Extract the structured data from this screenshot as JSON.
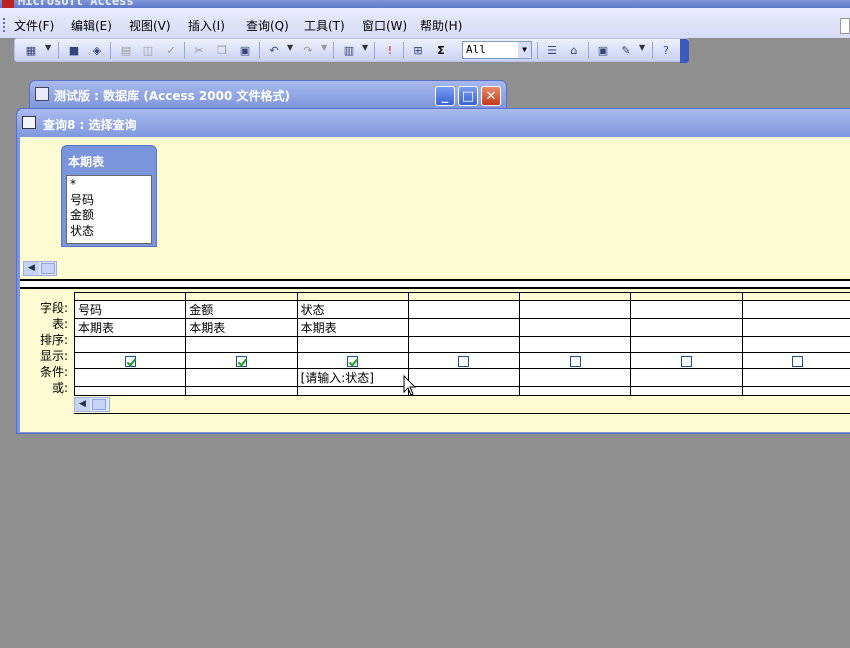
{
  "app": {
    "title": "Microsoft Access"
  },
  "menu": [
    "文件(F)",
    "编辑(E)",
    "视图(V)",
    "插入(I)",
    "查询(Q)",
    "工具(T)",
    "窗口(W)",
    "帮助(H)"
  ],
  "toolbar": {
    "filter_value": "All"
  },
  "db_window": {
    "title": "测试版 : 数据库 (Access 2000 文件格式)"
  },
  "query_window": {
    "title": "查询8 : 选择查询",
    "table": {
      "name": "本期表",
      "fields": [
        "*",
        "号码",
        "金额",
        "状态"
      ]
    },
    "row_labels": [
      "字段:",
      "表:",
      "排序:",
      "显示:",
      "条件:",
      "或:"
    ],
    "columns": [
      {
        "field": "号码",
        "table": "本期表",
        "show": true,
        "criteria": ""
      },
      {
        "field": "金额",
        "table": "本期表",
        "show": true,
        "criteria": ""
      },
      {
        "field": "状态",
        "table": "本期表",
        "show": true,
        "criteria": "[请输入:状态]"
      },
      {
        "field": "",
        "table": "",
        "show": false,
        "criteria": ""
      },
      {
        "field": "",
        "table": "",
        "show": false,
        "criteria": ""
      },
      {
        "field": "",
        "table": "",
        "show": false,
        "criteria": ""
      },
      {
        "field": "",
        "table": "",
        "show": false,
        "criteria": ""
      }
    ]
  }
}
